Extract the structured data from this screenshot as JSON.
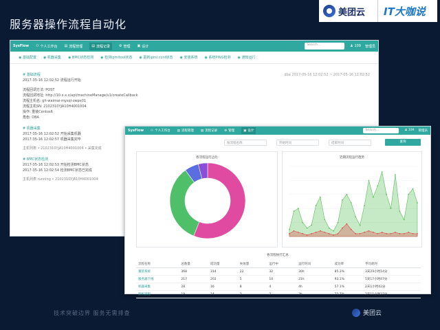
{
  "slide": {
    "title": "服务器操作流程自动化",
    "footer": "技术突破边界 服务无需排查",
    "footer_logo": "美团云"
  },
  "logos": {
    "meituan": "美团云",
    "it": "IT大咖说"
  },
  "back_window": {
    "brand": "SysFlow",
    "nav": [
      "个人工作台",
      "流程管理",
      "流程记录",
      "管理",
      "设计"
    ],
    "search_placeholder": "Search...",
    "user_count": "109",
    "user": "管理员",
    "steps": [
      "基础配置",
      "机器采集",
      "BMC状态检测",
      "检测ipmitool状态",
      "更新ipmi.conf状态",
      "安装系统",
      "系统PING检测",
      "通知运行"
    ],
    "header": {
      "title": "# 基础流程",
      "user": "dba",
      "time": "2017-05-16 12:02:52 ~ 2017-05-16 12:02:52"
    },
    "log_lines": [
      "2017-35-16 12:02:52 流程运行开始",
      "流程回调方法: POST",
      "流程回调地址: http://10.x.x.x/api/machineManage/v1/createCallback",
      "流程主机名: gh-waimai-mysql-zwpx01",
      "流程主机SN: 2102310YJA10H4001004",
      "操作: 重装Centos6",
      "角色: DBA"
    ],
    "section2": {
      "title": "# 机器采集",
      "lines": [
        "2017-35-16 12:02:52 开始采集机器",
        "2017-35-16 12:02:57 机器采集完毕"
      ],
      "row": "主机列表  •  2102310YJA10H4001004  •  采集完成"
    },
    "section3": {
      "title": "# BMC状态检测",
      "lines": [
        "2017-35-16 12:02:53 开始检测BMC状态",
        "2017-35-16 12:02:54 检测BMC状态已完成"
      ],
      "row": "主机列表  running  •  2102310YJA10H4001004"
    }
  },
  "front_window": {
    "brand": "SysFlow",
    "nav": [
      "个人工作台",
      "流程管理",
      "流程记录",
      "管理",
      "设计"
    ],
    "search_placeholder": "Search...",
    "user_count": "109",
    "user": "管理员",
    "filters": [
      "按流程名称",
      "开始时间",
      "结束时间"
    ],
    "query_button": "查询",
    "donut_title": "各流程运行占比",
    "trend_title": "近期流程运行趋势",
    "table_title": "各流程执行汇总",
    "table_headers": [
      "流程名称",
      "总数量",
      "成功量",
      "失败量",
      "运行中",
      "运行时间",
      "成功率",
      "平均耗时"
    ],
    "table_rows": [
      [
        "重装系统",
        "368",
        "314",
        "22",
        "32",
        "30h",
        "85.3%",
        "3天23小时14分"
      ],
      [
        "服务器下线",
        "217",
        "202",
        "5",
        "10",
        "21h",
        "93.1%",
        "5天17小时47分"
      ],
      [
        "机器采集",
        "28",
        "16",
        "8",
        "4",
        "4h",
        "57.1%",
        "2天1小时42分"
      ],
      [
        "装机流程",
        "19",
        "14",
        "3",
        "2",
        "3h",
        "73.7%",
        "2天11小时37分"
      ]
    ]
  },
  "chart_data": [
    {
      "type": "pie",
      "title": "各流程运行占比",
      "categories": [
        "重装系统",
        "服务器下线",
        "机器采集",
        "装机流程"
      ],
      "values": [
        0.56,
        0.34,
        0.06,
        0.04
      ],
      "colors": [
        "#e04aa0",
        "#4fbf6a",
        "#5b6ee0",
        "#8a4fd8"
      ]
    },
    {
      "type": "area",
      "title": "近期流程运行趋势",
      "x": [
        1,
        2,
        3,
        4,
        5,
        6,
        7,
        8,
        9,
        10,
        11,
        12,
        13,
        14,
        15,
        16,
        17,
        18,
        19,
        20,
        21,
        22,
        23,
        24,
        25,
        26,
        27,
        28,
        29,
        30
      ],
      "series": [
        {
          "values": [
            5,
            18,
            20,
            10,
            6,
            8,
            22,
            28,
            12,
            6,
            4,
            10,
            26,
            30,
            24,
            14,
            8,
            22,
            40,
            28,
            36,
            46,
            30,
            20,
            44,
            18,
            12,
            30,
            34,
            24
          ],
          "color": "#5cbf5c"
        },
        {
          "values": [
            2,
            4,
            3,
            2,
            1,
            2,
            3,
            4,
            3,
            2,
            1,
            2,
            6,
            9,
            5,
            2,
            2,
            3,
            4,
            3,
            2,
            3,
            2,
            2,
            3,
            2,
            2,
            3,
            2,
            2
          ],
          "color": "#e05050"
        }
      ],
      "ylim": [
        0,
        50
      ]
    }
  ]
}
